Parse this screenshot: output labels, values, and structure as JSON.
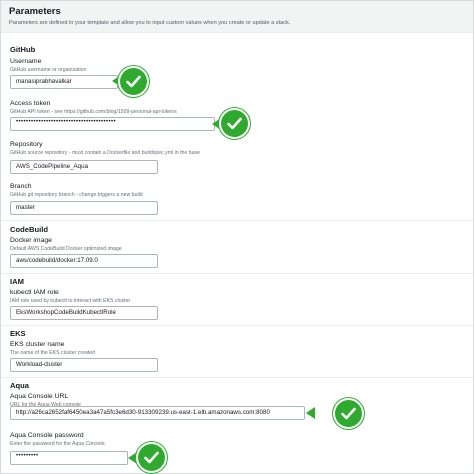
{
  "header": {
    "title": "Parameters",
    "description": "Parameters are defined in your template and allow you to input custom values when you create or update a stack."
  },
  "sections": {
    "github": "GitHub",
    "codebuild": "CodeBuild",
    "iam": "IAM",
    "eks": "EKS",
    "aqua": "Aqua"
  },
  "fields": {
    "username": {
      "label": "Username",
      "description": "GitHub username or organization",
      "value": "manasiprabhavalkar"
    },
    "access_token": {
      "label": "Access token",
      "description": "GitHub API token - see https://github.com/blog/1509-personal-api-tokens",
      "value": "••••••••••••••••••••••••••••••••••••••••"
    },
    "repository": {
      "label": "Repository",
      "description": "GitHub source repository - must contain a Dockerfile and buildspec.yml in the base",
      "value": "AWS_CodePipeline_Aqua"
    },
    "branch": {
      "label": "Branch",
      "description": "GitHub git repository branch - change triggers a new build",
      "value": "master"
    },
    "docker_image": {
      "label": "Docker image",
      "description": "Default AWS CodeBuild Docker optimized image",
      "value": "aws/codebuild/docker:17.09.0"
    },
    "kubectl_role": {
      "label": "kubectl IAM role",
      "description": "IAM role used by kubectl to interact with EKS cluster",
      "value": "EksWorkshopCodeBuildKubectlRole"
    },
    "eks_cluster": {
      "label": "EKS cluster name",
      "description": "The name of the EKS cluster created",
      "value": "Workload-cluster"
    },
    "aqua_url": {
      "label": "Aqua Console URL",
      "description": "URL for the Aqua Web console",
      "value": "http://a26ca2652faf6450ea3a47a5fc3e6d30-913309239.us-east-1.elb.amazonaws.com:8080"
    },
    "aqua_password": {
      "label": "Aqua Console password",
      "description": "Enter the password for the Aqua Console.",
      "value": "•••••••••"
    }
  },
  "icons": {
    "annotation": "check-circle-icon"
  },
  "colors": {
    "annotation_green": "#2faa2f",
    "header_bg": "#f2f3f3",
    "input_border": "#aab7b8"
  }
}
